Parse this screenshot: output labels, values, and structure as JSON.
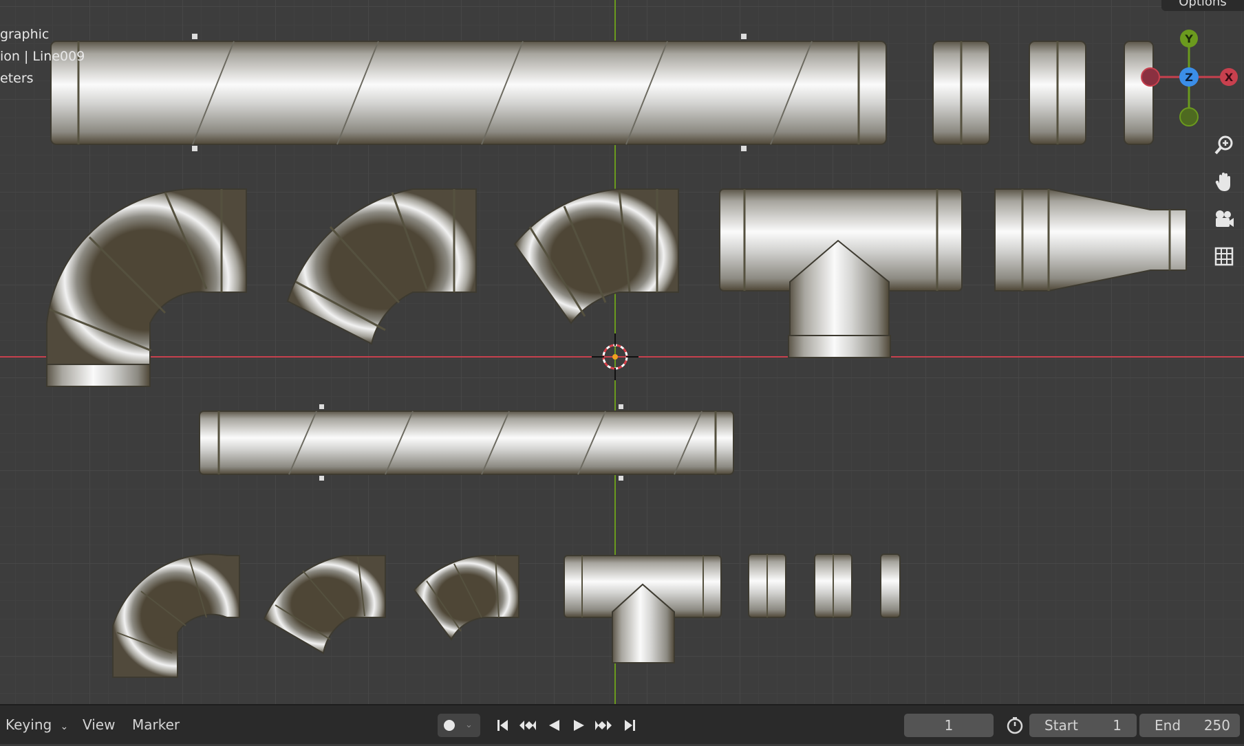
{
  "viewport": {
    "overlay_lines": [
      "graphic",
      "ion | Line009",
      "eters"
    ],
    "options_label": "Options",
    "gizmo": {
      "y": "Y",
      "z": "Z",
      "x": "X"
    },
    "nav_icons": [
      "zoom-icon",
      "hand-icon",
      "camera-icon",
      "grid-icon"
    ]
  },
  "timeline": {
    "keying_label": "Keying",
    "view_label": "View",
    "marker_label": "Marker",
    "current_frame": "1",
    "start_label": "Start",
    "start_value": "1",
    "end_label": "End",
    "end_value": "250"
  },
  "colors": {
    "axis_x": "#c8404e",
    "axis_y": "#6b9a1e",
    "axis_z": "#3b8ee8"
  }
}
